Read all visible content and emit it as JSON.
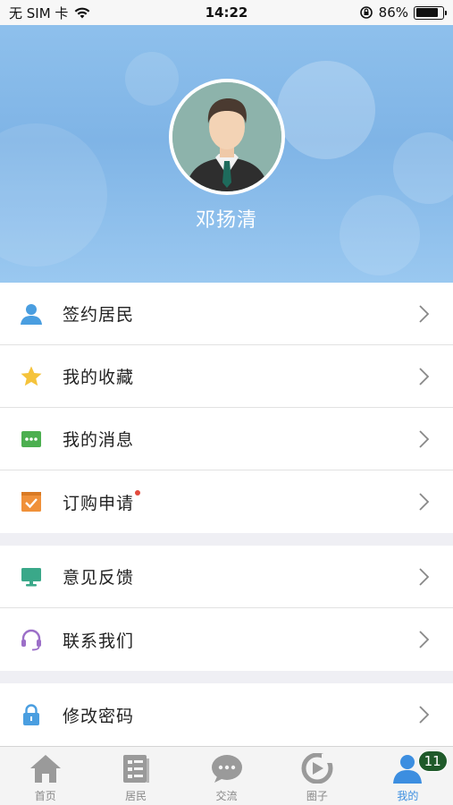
{
  "status_bar": {
    "carrier": "无 SIM 卡",
    "time": "14:22",
    "battery": "86%",
    "battery_level": 0.86,
    "icons": [
      "wifi-icon",
      "orientation-lock-icon",
      "battery-icon"
    ]
  },
  "profile": {
    "name": "邓扬清",
    "avatar_icon": "person-avatar"
  },
  "menu": {
    "group1": [
      {
        "label": "签约居民",
        "icon": "person-icon",
        "color": "#4a9ee0"
      },
      {
        "label": "我的收藏",
        "icon": "star-icon",
        "color": "#f5c33b"
      },
      {
        "label": "我的消息",
        "icon": "message-icon",
        "color": "#4caf50"
      },
      {
        "label": "订购申请",
        "icon": "order-check-icon",
        "color": "#f0913a",
        "has_dot": true
      }
    ],
    "group2": [
      {
        "label": "意见反馈",
        "icon": "monitor-icon",
        "color": "#3aa889"
      },
      {
        "label": "联系我们",
        "icon": "headset-icon",
        "color": "#9c6fc8"
      }
    ],
    "group3": [
      {
        "label": "修改密码",
        "icon": "lock-icon",
        "color": "#4a9ee0"
      }
    ]
  },
  "tab_bar": {
    "tabs": [
      {
        "label": "首页",
        "icon": "home-icon"
      },
      {
        "label": "居民",
        "icon": "resident-list-icon"
      },
      {
        "label": "交流",
        "icon": "chat-icon"
      },
      {
        "label": "圈子",
        "icon": "circle-icon"
      },
      {
        "label": "我的",
        "icon": "profile-icon",
        "active": true,
        "badge": "11"
      }
    ],
    "active_color": "#3c8ee0",
    "inactive_color": "#9a9a9a"
  }
}
